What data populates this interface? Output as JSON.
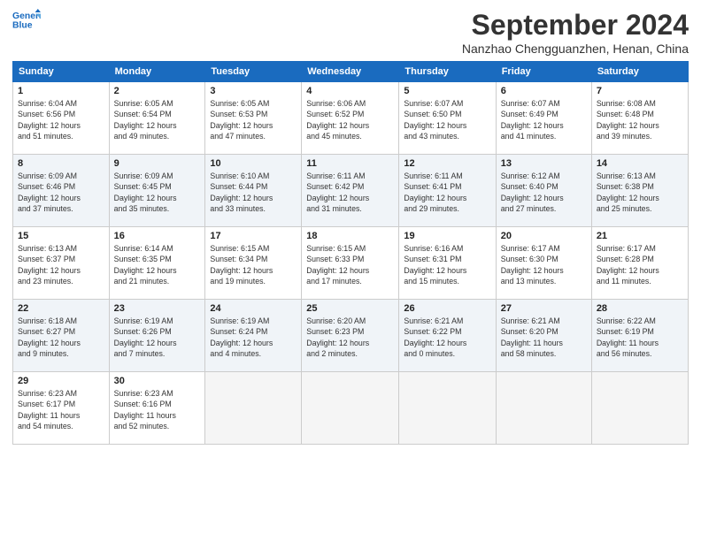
{
  "logo": {
    "line1": "General",
    "line2": "Blue"
  },
  "title": "September 2024",
  "location": "Nanzhao Chengguanzhen, Henan, China",
  "days_header": [
    "Sunday",
    "Monday",
    "Tuesday",
    "Wednesday",
    "Thursday",
    "Friday",
    "Saturday"
  ],
  "weeks": [
    [
      {
        "day": "1",
        "info": "Sunrise: 6:04 AM\nSunset: 6:56 PM\nDaylight: 12 hours\nand 51 minutes."
      },
      {
        "day": "2",
        "info": "Sunrise: 6:05 AM\nSunset: 6:54 PM\nDaylight: 12 hours\nand 49 minutes."
      },
      {
        "day": "3",
        "info": "Sunrise: 6:05 AM\nSunset: 6:53 PM\nDaylight: 12 hours\nand 47 minutes."
      },
      {
        "day": "4",
        "info": "Sunrise: 6:06 AM\nSunset: 6:52 PM\nDaylight: 12 hours\nand 45 minutes."
      },
      {
        "day": "5",
        "info": "Sunrise: 6:07 AM\nSunset: 6:50 PM\nDaylight: 12 hours\nand 43 minutes."
      },
      {
        "day": "6",
        "info": "Sunrise: 6:07 AM\nSunset: 6:49 PM\nDaylight: 12 hours\nand 41 minutes."
      },
      {
        "day": "7",
        "info": "Sunrise: 6:08 AM\nSunset: 6:48 PM\nDaylight: 12 hours\nand 39 minutes."
      }
    ],
    [
      {
        "day": "8",
        "info": "Sunrise: 6:09 AM\nSunset: 6:46 PM\nDaylight: 12 hours\nand 37 minutes."
      },
      {
        "day": "9",
        "info": "Sunrise: 6:09 AM\nSunset: 6:45 PM\nDaylight: 12 hours\nand 35 minutes."
      },
      {
        "day": "10",
        "info": "Sunrise: 6:10 AM\nSunset: 6:44 PM\nDaylight: 12 hours\nand 33 minutes."
      },
      {
        "day": "11",
        "info": "Sunrise: 6:11 AM\nSunset: 6:42 PM\nDaylight: 12 hours\nand 31 minutes."
      },
      {
        "day": "12",
        "info": "Sunrise: 6:11 AM\nSunset: 6:41 PM\nDaylight: 12 hours\nand 29 minutes."
      },
      {
        "day": "13",
        "info": "Sunrise: 6:12 AM\nSunset: 6:40 PM\nDaylight: 12 hours\nand 27 minutes."
      },
      {
        "day": "14",
        "info": "Sunrise: 6:13 AM\nSunset: 6:38 PM\nDaylight: 12 hours\nand 25 minutes."
      }
    ],
    [
      {
        "day": "15",
        "info": "Sunrise: 6:13 AM\nSunset: 6:37 PM\nDaylight: 12 hours\nand 23 minutes."
      },
      {
        "day": "16",
        "info": "Sunrise: 6:14 AM\nSunset: 6:35 PM\nDaylight: 12 hours\nand 21 minutes."
      },
      {
        "day": "17",
        "info": "Sunrise: 6:15 AM\nSunset: 6:34 PM\nDaylight: 12 hours\nand 19 minutes."
      },
      {
        "day": "18",
        "info": "Sunrise: 6:15 AM\nSunset: 6:33 PM\nDaylight: 12 hours\nand 17 minutes."
      },
      {
        "day": "19",
        "info": "Sunrise: 6:16 AM\nSunset: 6:31 PM\nDaylight: 12 hours\nand 15 minutes."
      },
      {
        "day": "20",
        "info": "Sunrise: 6:17 AM\nSunset: 6:30 PM\nDaylight: 12 hours\nand 13 minutes."
      },
      {
        "day": "21",
        "info": "Sunrise: 6:17 AM\nSunset: 6:28 PM\nDaylight: 12 hours\nand 11 minutes."
      }
    ],
    [
      {
        "day": "22",
        "info": "Sunrise: 6:18 AM\nSunset: 6:27 PM\nDaylight: 12 hours\nand 9 minutes."
      },
      {
        "day": "23",
        "info": "Sunrise: 6:19 AM\nSunset: 6:26 PM\nDaylight: 12 hours\nand 7 minutes."
      },
      {
        "day": "24",
        "info": "Sunrise: 6:19 AM\nSunset: 6:24 PM\nDaylight: 12 hours\nand 4 minutes."
      },
      {
        "day": "25",
        "info": "Sunrise: 6:20 AM\nSunset: 6:23 PM\nDaylight: 12 hours\nand 2 minutes."
      },
      {
        "day": "26",
        "info": "Sunrise: 6:21 AM\nSunset: 6:22 PM\nDaylight: 12 hours\nand 0 minutes."
      },
      {
        "day": "27",
        "info": "Sunrise: 6:21 AM\nSunset: 6:20 PM\nDaylight: 11 hours\nand 58 minutes."
      },
      {
        "day": "28",
        "info": "Sunrise: 6:22 AM\nSunset: 6:19 PM\nDaylight: 11 hours\nand 56 minutes."
      }
    ],
    [
      {
        "day": "29",
        "info": "Sunrise: 6:23 AM\nSunset: 6:17 PM\nDaylight: 11 hours\nand 54 minutes."
      },
      {
        "day": "30",
        "info": "Sunrise: 6:23 AM\nSunset: 6:16 PM\nDaylight: 11 hours\nand 52 minutes."
      },
      {
        "day": "",
        "info": ""
      },
      {
        "day": "",
        "info": ""
      },
      {
        "day": "",
        "info": ""
      },
      {
        "day": "",
        "info": ""
      },
      {
        "day": "",
        "info": ""
      }
    ]
  ]
}
